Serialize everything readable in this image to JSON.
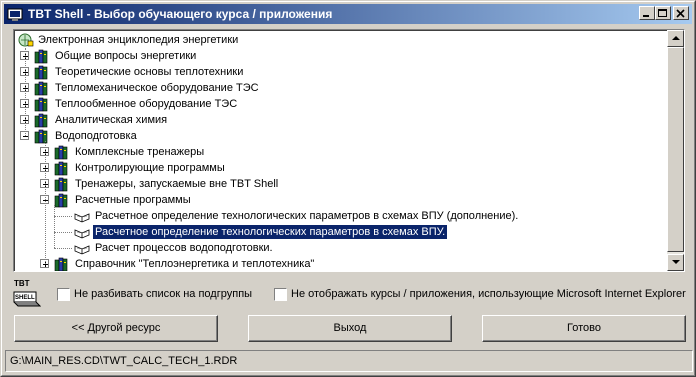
{
  "window": {
    "title": "TBT Shell - Выбор обучающего курса / приложения",
    "controls": [
      "minimize",
      "maximize",
      "close"
    ]
  },
  "tree": {
    "items": [
      {
        "label": "Электронная энциклопедия энергетики",
        "level": 0,
        "icon": "encyclopedia-icon",
        "expander": "none",
        "selected": false
      },
      {
        "label": "Общие вопросы энергетики",
        "level": 0,
        "icon": "books-icon",
        "expander": "plus",
        "selected": false
      },
      {
        "label": "Теоретические основы теплотехники",
        "level": 0,
        "icon": "books-icon",
        "expander": "plus",
        "selected": false
      },
      {
        "label": "Тепломеханическое оборудование ТЭС",
        "level": 0,
        "icon": "books-icon",
        "expander": "plus",
        "selected": false
      },
      {
        "label": "Теплообменное оборудование ТЭС",
        "level": 0,
        "icon": "books-icon",
        "expander": "plus",
        "selected": false
      },
      {
        "label": "Аналитическая химия",
        "level": 0,
        "icon": "books-icon",
        "expander": "plus",
        "selected": false
      },
      {
        "label": "Водоподготовка",
        "level": 0,
        "icon": "books-icon",
        "expander": "minus",
        "selected": false
      },
      {
        "label": "Комплексные тренажеры",
        "level": 1,
        "icon": "books-icon",
        "expander": "plus",
        "selected": false
      },
      {
        "label": "Контролирующие программы",
        "level": 1,
        "icon": "books-icon",
        "expander": "plus",
        "selected": false
      },
      {
        "label": "Тренажеры, запускаемые вне TBT Shell",
        "level": 1,
        "icon": "books-icon",
        "expander": "plus",
        "selected": false
      },
      {
        "label": "Расчетные программы",
        "level": 1,
        "icon": "books-icon",
        "expander": "minus",
        "selected": false
      },
      {
        "label": "Расчетное определение технологических параметров в схемах ВПУ (дополнение).",
        "level": 2,
        "icon": "open-book-icon",
        "expander": "none",
        "selected": false
      },
      {
        "label": "Расчетное определение технологических параметров в схемах ВПУ.",
        "level": 2,
        "icon": "open-book-icon",
        "expander": "none",
        "selected": true
      },
      {
        "label": "Расчет процессов водоподготовки.",
        "level": 2,
        "icon": "open-book-icon",
        "expander": "none",
        "selected": false
      },
      {
        "label": "Справочник \"Теплоэнергетика и теплотехника\"",
        "level": 1,
        "icon": "books-icon",
        "expander": "plus",
        "selected": false
      }
    ]
  },
  "options": {
    "logo_text_top": "TBT",
    "logo_text_bottom": "SHELL",
    "no_split_label": "Не разбивать список на подгруппы",
    "no_split_checked": false,
    "hide_ie_label": "Не отображать курсы / приложения, использующие Microsoft Internet Explorer",
    "hide_ie_checked": false
  },
  "buttons": {
    "other_resource": "<< Другой ресурс",
    "exit": "Выход",
    "ready": "Готово"
  },
  "status": {
    "path": "G:\\MAIN_RES.CD\\TWT_CALC_TECH_1.RDR"
  },
  "colors": {
    "title_gradient_start": "#0a246a",
    "title_gradient_end": "#a6caf0",
    "selection": "#0a246a",
    "face": "#d4d0c8"
  }
}
